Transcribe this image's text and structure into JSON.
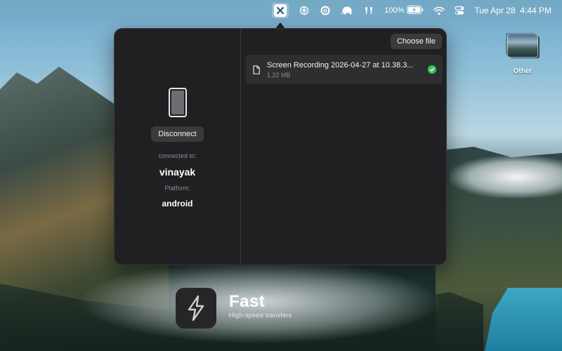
{
  "menubar": {
    "app_icon": "close-x-icon",
    "icons": [
      "openai-icon",
      "target-icon",
      "elephant-icon",
      "airpods-icon"
    ],
    "battery_percent": "100%",
    "battery_icon": "battery-charging-icon",
    "wifi_icon": "wifi-icon",
    "control_center_icon": "control-center-icon",
    "datetime": "Tue Apr 28  4:44 PM"
  },
  "popover": {
    "left": {
      "device_icon": "phone-icon",
      "disconnect_label": "Disconnect",
      "connected_to_label": "connected to:",
      "device_name": "vinayak",
      "platform_label": "Platform:",
      "platform_value": "android"
    },
    "right": {
      "choose_file_label": "Choose file",
      "files": [
        {
          "name": "Screen Recording 2026-04-27 at 10.38.3...",
          "size": "1.22 MB",
          "status": "complete"
        }
      ]
    }
  },
  "desktop": {
    "items": [
      {
        "label": "Other"
      }
    ]
  },
  "banner": {
    "icon": "bolt-icon",
    "title": "Fast",
    "subtitle": "High-speed transfers"
  },
  "colors": {
    "accent_success": "#34c759",
    "popover_bg": "#202023",
    "button_bg": "#3a3a3d"
  }
}
